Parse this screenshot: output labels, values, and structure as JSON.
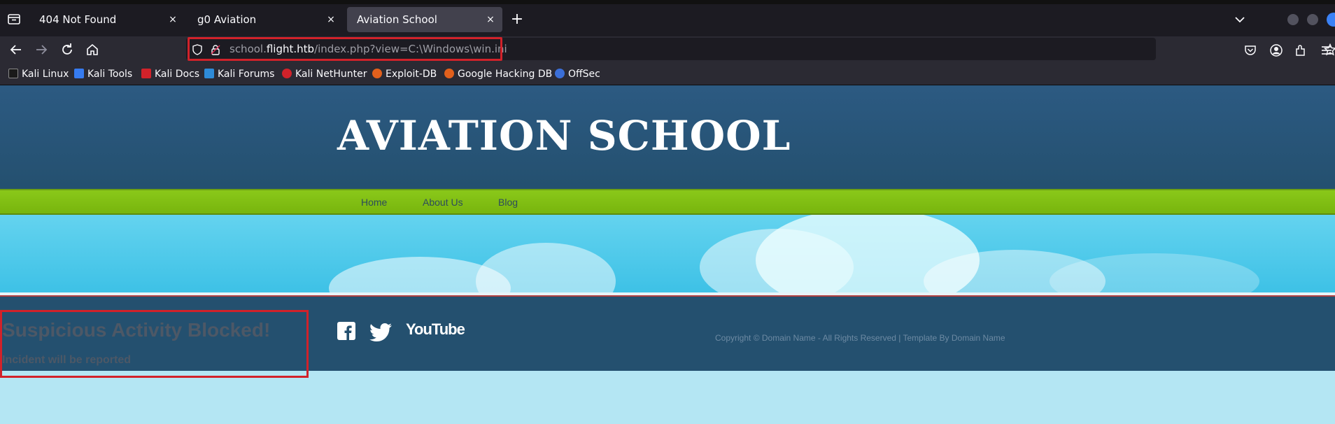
{
  "tabs": [
    {
      "title": "404 Not Found",
      "active": false
    },
    {
      "title": "g0 Aviation",
      "active": false
    },
    {
      "title": "Aviation School",
      "active": true
    }
  ],
  "tab_close_glyph": "×",
  "new_tab_glyph": "+",
  "url": {
    "prefix": "school.",
    "host": "flight.htb",
    "path": "/index.php?view=C:\\Windows\\win.ini"
  },
  "bookmarks": [
    {
      "label": "Kali Linux",
      "icon": "kali-icon",
      "color": "#1a1a1a"
    },
    {
      "label": "Kali Tools",
      "icon": "kali-tools-icon",
      "color": "#367bf0"
    },
    {
      "label": "Kali Docs",
      "icon": "kali-docs-icon",
      "color": "#d1222a"
    },
    {
      "label": "Kali Forums",
      "icon": "kali-forums-icon",
      "color": "#2e8bd8"
    },
    {
      "label": "Kali NetHunter",
      "icon": "nethunter-icon",
      "color": "#d1222a"
    },
    {
      "label": "Exploit-DB",
      "icon": "exploit-db-icon",
      "color": "#e2601c"
    },
    {
      "label": "Google Hacking DB",
      "icon": "ghdb-icon",
      "color": "#e2601c"
    },
    {
      "label": "OffSec",
      "icon": "offsec-icon",
      "color": "#3b6fd8"
    }
  ],
  "site": {
    "title": "AVIATION SCHOOL",
    "menu": [
      "Home",
      "About Us",
      "Blog"
    ],
    "alert_title": "Suspicious Activity Blocked!",
    "alert_sub": "Incident will be reported",
    "social": [
      "facebook-icon",
      "twitter-icon",
      "youtube-icon"
    ],
    "youtube_label": "YouTube",
    "copyright": "Copyright © Domain Name - All Rights Reserved | Template By Domain Name"
  },
  "colors": {
    "header_blue": "#24506f",
    "menu_green": "#7fbd12",
    "alert_red": "#d1222a"
  }
}
